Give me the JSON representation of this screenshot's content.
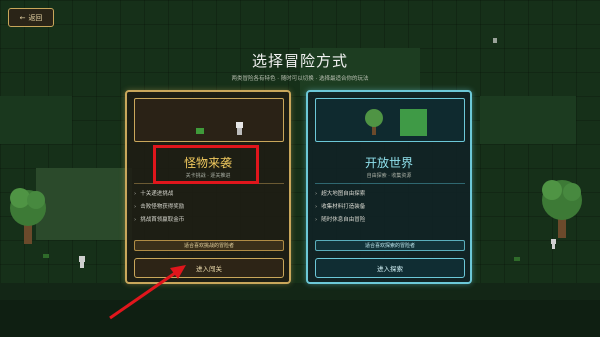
{
  "back_button": {
    "label": "返回",
    "icon": "arrow-left-icon"
  },
  "header": {
    "title": "选择冒险方式",
    "subtitle": "两类冒险各有特色 · 随时可以切换 · 选择最适合你的玩法"
  },
  "cards": [
    {
      "title": "怪物来袭",
      "subtitle": "关卡挑战 · 逐关推进",
      "features": [
        "十关递进挑战",
        "击败怪物获得奖励",
        "挑战首领赢取金币"
      ],
      "note": "适合喜欢挑战的冒险者",
      "enter_label": "进入闯关"
    },
    {
      "title": "开放世界",
      "subtitle": "自由探索 · 收集资源",
      "features": [
        "超大地图自由探索",
        "收集材料打造装备",
        "随时休息自由冒险"
      ],
      "note": "适合喜欢探索的冒险者",
      "enter_label": "进入探索"
    }
  ],
  "colors": {
    "gold_accent": "#c9a75b",
    "cyan_accent": "#6cc8d8",
    "highlight": "#e0161c",
    "background": "#163019"
  }
}
